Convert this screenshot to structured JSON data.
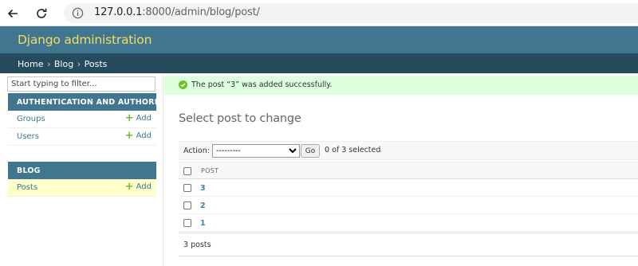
{
  "browser": {
    "url_host": "127.0.0.1",
    "url_path": ":8000/admin/blog/post/"
  },
  "header": {
    "site_title": "Django administration"
  },
  "breadcrumbs": {
    "home": "Home",
    "separator": "›",
    "app": "Blog",
    "current": "Posts"
  },
  "sidebar": {
    "filter_placeholder": "Start typing to filter...",
    "modules": [
      {
        "caption": "AUTHENTICATION AND AUTHORIZATION",
        "models": [
          {
            "name": "Groups",
            "add": "Add"
          },
          {
            "name": "Users",
            "add": "Add"
          }
        ]
      },
      {
        "caption": "BLOG",
        "models": [
          {
            "name": "Posts",
            "add": "Add",
            "current": true
          }
        ]
      }
    ]
  },
  "message": {
    "text": "The post “3” was added successfully."
  },
  "content": {
    "title": "Select post to change",
    "action_label": "Action:",
    "action_value": "---------",
    "go_label": "Go",
    "selected_text": "0 of 3 selected",
    "column_header": "POST",
    "rows": [
      "3",
      "2",
      "1"
    ],
    "paginator": "3 posts"
  },
  "colors": {
    "header_bg": "#417690",
    "breadcrumbs_bg": "#264b5d",
    "title_yellow": "#f5dd5d",
    "success_bg": "#dfd",
    "link_blue": "#447e9b",
    "add_green": "#70bf2b",
    "current_row_bg": "#ffffcc"
  }
}
